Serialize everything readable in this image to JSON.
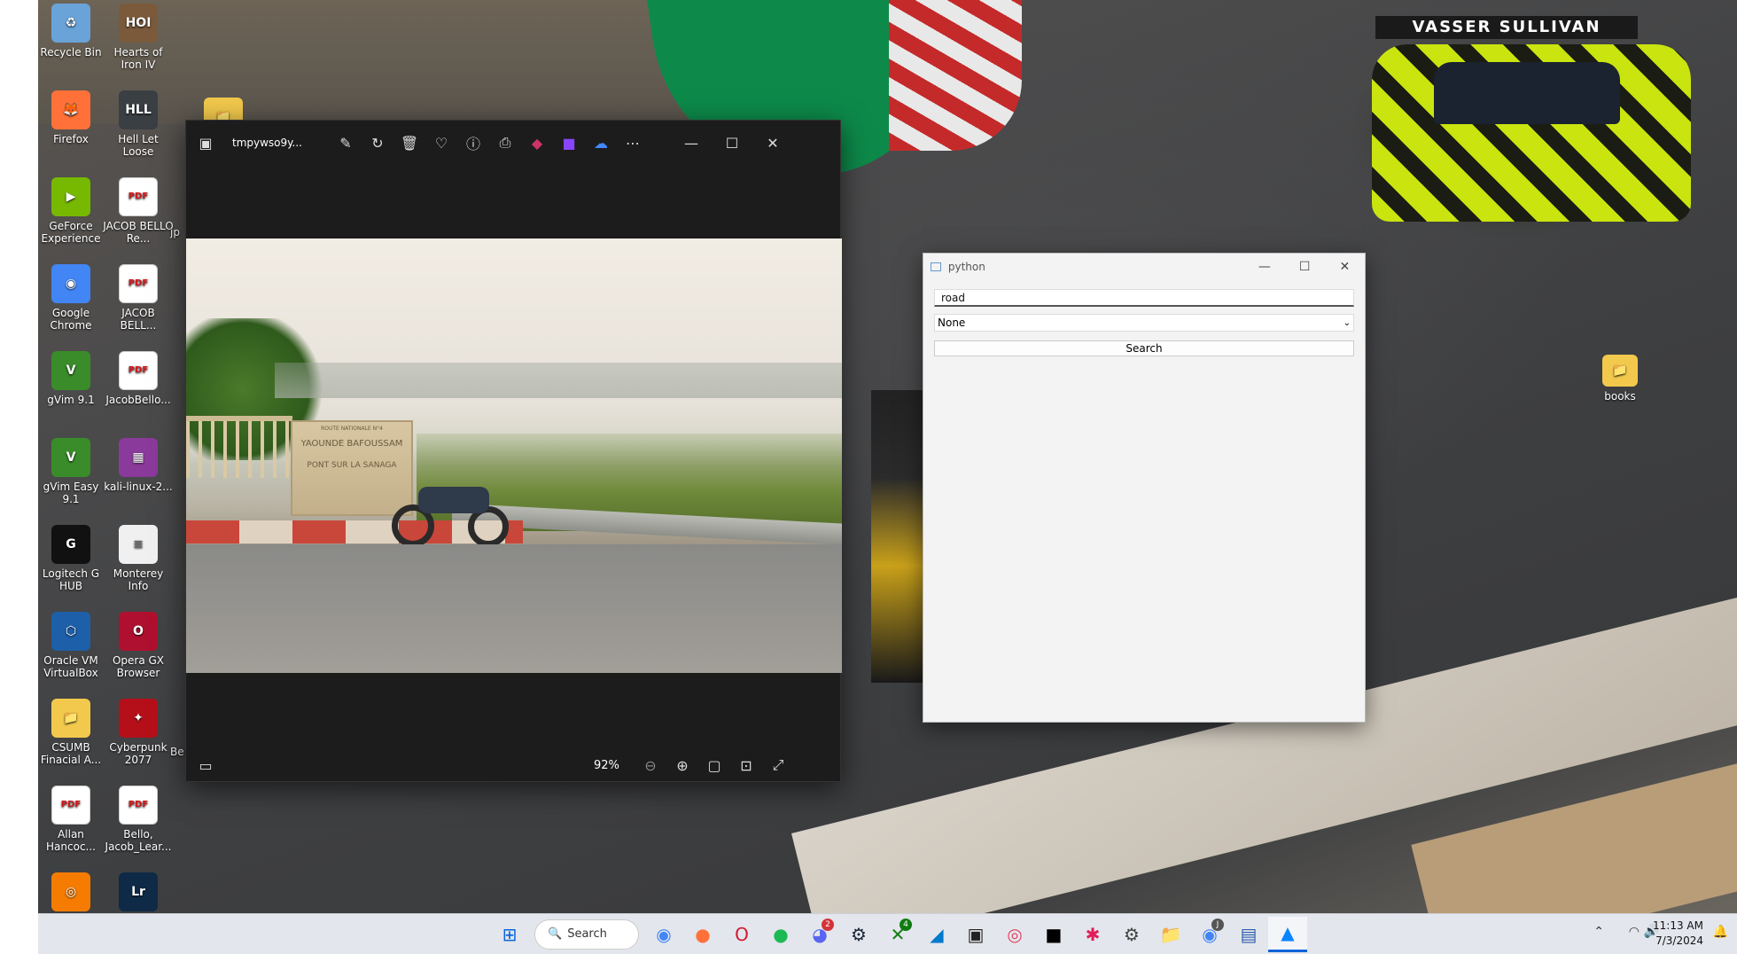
{
  "desktop_icons": [
    {
      "label": "Recycle Bin",
      "glyph": "♻",
      "bg": "#6aa3d8"
    },
    {
      "label": "Hearts of Iron IV",
      "glyph": "HOI",
      "bg": "#7a5a3a"
    },
    {
      "label": "Firefox",
      "glyph": "🦊",
      "bg": "#ff7139"
    },
    {
      "label": "Hell Let Loose",
      "glyph": "HLL",
      "bg": "#3a3f44"
    },
    {
      "label": "GeForce Experience",
      "glyph": "▶",
      "bg": "#76b900"
    },
    {
      "label": "JACOB BELLO Re...",
      "glyph": "PDF",
      "bg": "pdf"
    },
    {
      "label": "Google Chrome",
      "glyph": "◉",
      "bg": "#4285f4"
    },
    {
      "label": "JACOB BELL...",
      "glyph": "PDF",
      "bg": "pdf"
    },
    {
      "label": "gVim 9.1",
      "glyph": "V",
      "bg": "#3a8c2a"
    },
    {
      "label": "JacobBello...",
      "glyph": "PDF",
      "bg": "pdf"
    },
    {
      "label": "gVim Easy 9.1",
      "glyph": "V",
      "bg": "#3a8c2a"
    },
    {
      "label": "kali-linux-2...",
      "glyph": "▦",
      "bg": "#8a3a9a"
    },
    {
      "label": "Logitech G HUB",
      "glyph": "G",
      "bg": "#111"
    },
    {
      "label": "Monterey Info",
      "glyph": "≡",
      "bg": "#f0f0f0"
    },
    {
      "label": "Oracle VM VirtualBox",
      "glyph": "⬡",
      "bg": "#1d5fa8"
    },
    {
      "label": "Opera GX Browser",
      "glyph": "O",
      "bg": "#b01030"
    },
    {
      "label": "CSUMB Finacial A...",
      "glyph": "📁",
      "bg": "#f2c94c"
    },
    {
      "label": "Cyberpunk 2077",
      "glyph": "✦",
      "bg": "#b50f1a"
    },
    {
      "label": "Allan Hancoc...",
      "glyph": "PDF",
      "bg": "pdf"
    },
    {
      "label": "Bello, Jacob_Lear...",
      "glyph": "PDF",
      "bg": "pdf"
    },
    {
      "label": "",
      "glyph": "◎",
      "bg": "#f57c00"
    },
    {
      "label": "Lightroom",
      "glyph": "Lr",
      "bg": "#0e2a47"
    }
  ],
  "partial_labels": [
    "jp",
    "jp",
    "Be"
  ],
  "books_label": "books",
  "car_wing_text": "VASSER SULLIVAN",
  "viewer": {
    "filename": "tmpywso9y...",
    "zoom": "92%",
    "sign_line1": "ROUTE NATIONALE N°4",
    "sign_line2": "YAOUNDE BAFOUSSAM",
    "sign_line3": "PONT SUR LA SANAGA"
  },
  "python_window": {
    "title": "python",
    "query_value": "road",
    "select_value": "None",
    "search_label": "Search"
  },
  "taskbar": {
    "search_label": "Search",
    "time": "11:13 AM",
    "date": "7/3/2024",
    "discord_badge": "2",
    "xbox_badge": "4",
    "chrome2_badge": "J"
  }
}
